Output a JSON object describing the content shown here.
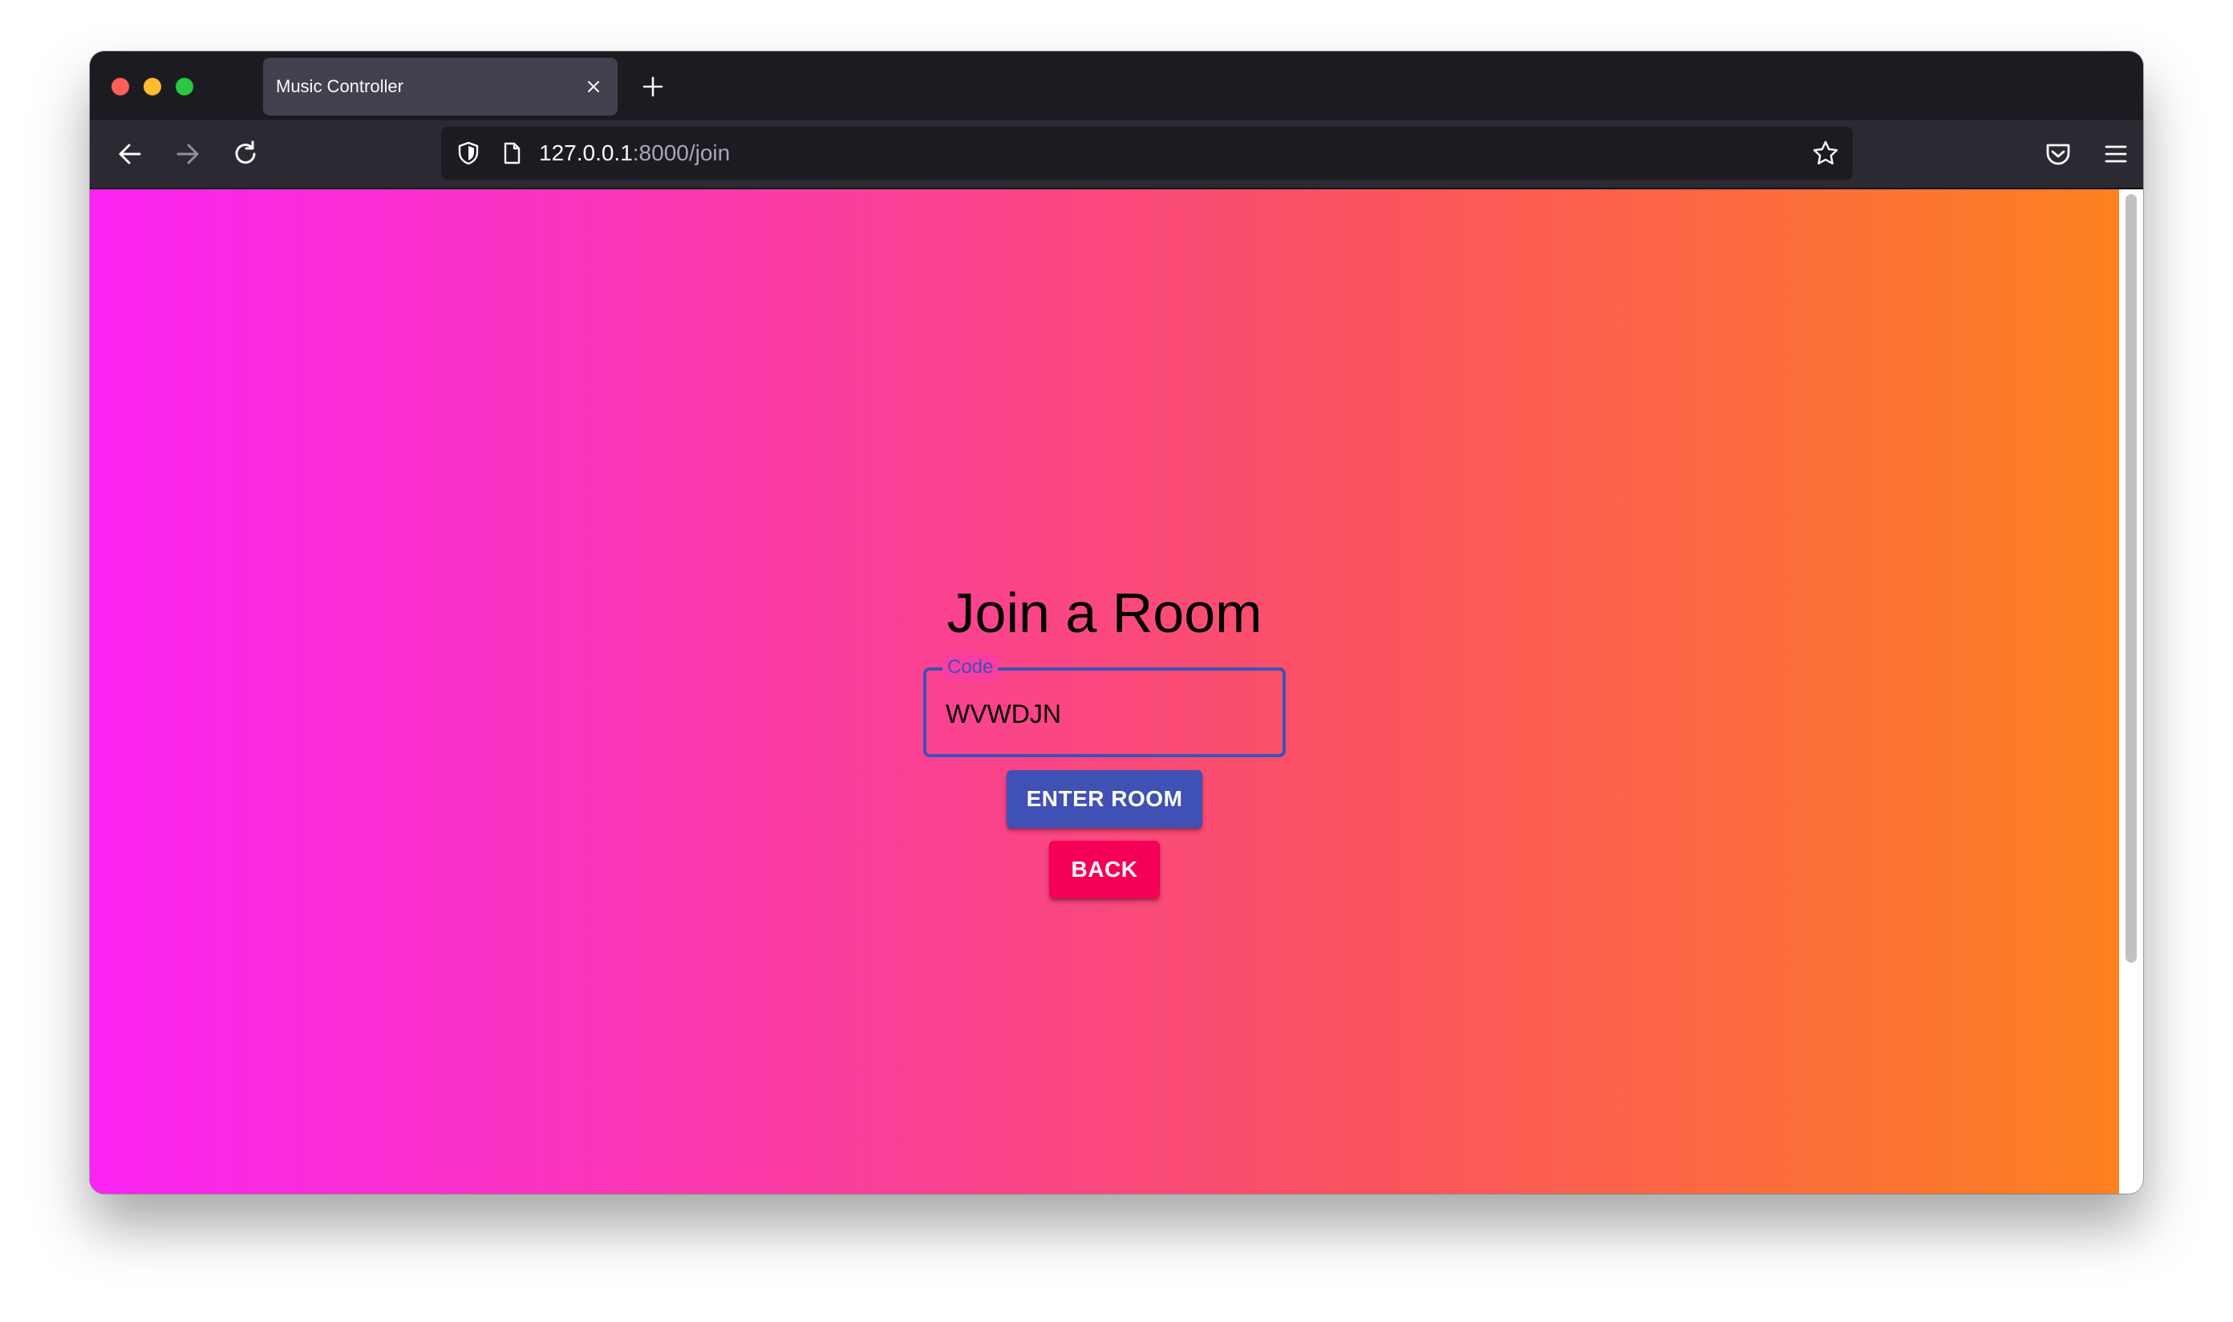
{
  "browser": {
    "tab": {
      "title": "Music Controller",
      "close_icon": "close-icon"
    },
    "new_tab_icon": "plus-icon",
    "nav": {
      "back_icon": "arrow-left-icon",
      "forward_icon": "arrow-right-icon",
      "reload_icon": "reload-icon"
    },
    "url": {
      "host": "127.0.0.1",
      "path": ":8000/join"
    },
    "icons": {
      "shield": "shield-icon",
      "page": "page-icon",
      "bookmark": "star-icon",
      "pocket": "pocket-icon",
      "menu": "hamburger-menu-icon"
    }
  },
  "page": {
    "heading": "Join a Room",
    "code_field": {
      "label": "Code",
      "value": "WVWDJN"
    },
    "buttons": {
      "enter_room": "ENTER ROOM",
      "back": "BACK"
    }
  },
  "colors": {
    "gradient_start": "#fb23f4",
    "gradient_end": "#fc831e",
    "primary": "#3f51b5",
    "secondary": "#f50057"
  }
}
